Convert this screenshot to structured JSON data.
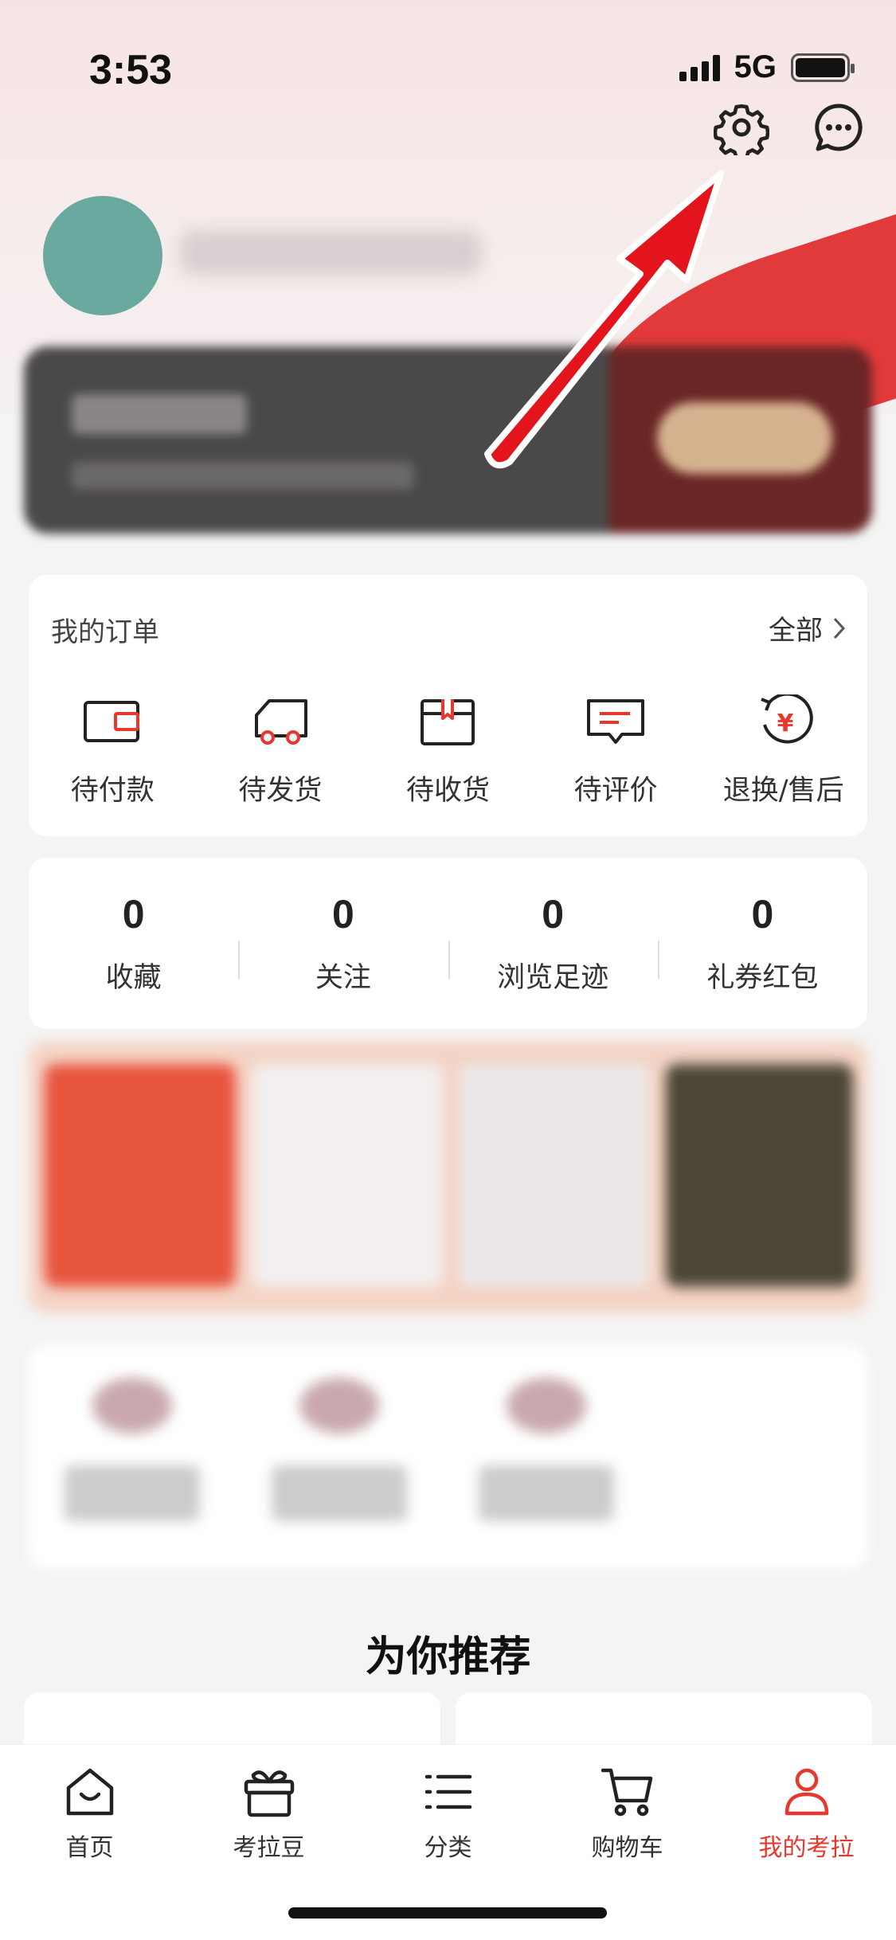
{
  "status_bar": {
    "time": "3:53",
    "network": "5G",
    "battery_level": 1.0
  },
  "header": {
    "settings_icon": "gear-icon",
    "message_icon": "chat-bubble-icon"
  },
  "orders": {
    "title": "我的订单",
    "all_label": "全部",
    "items": [
      {
        "label": "待付款",
        "icon": "wallet-icon"
      },
      {
        "label": "待发货",
        "icon": "truck-icon"
      },
      {
        "label": "待收货",
        "icon": "package-icon"
      },
      {
        "label": "待评价",
        "icon": "comment-icon"
      },
      {
        "label": "退换/售后",
        "icon": "refund-icon"
      }
    ]
  },
  "stats": [
    {
      "value": "0",
      "label": "收藏"
    },
    {
      "value": "0",
      "label": "关注"
    },
    {
      "value": "0",
      "label": "浏览足迹"
    },
    {
      "value": "0",
      "label": "礼券红包"
    }
  ],
  "recommend": {
    "title": "为你推荐"
  },
  "tabbar": {
    "items": [
      {
        "label": "首页",
        "icon": "home-icon"
      },
      {
        "label": "考拉豆",
        "icon": "gift-icon"
      },
      {
        "label": "分类",
        "icon": "list-icon"
      },
      {
        "label": "购物车",
        "icon": "cart-icon"
      },
      {
        "label": "我的考拉",
        "icon": "user-icon",
        "active": true
      }
    ]
  },
  "colors": {
    "accent": "#e8382e",
    "annotation_arrow": "#e3141b",
    "avatar": "#6aa9a0"
  }
}
